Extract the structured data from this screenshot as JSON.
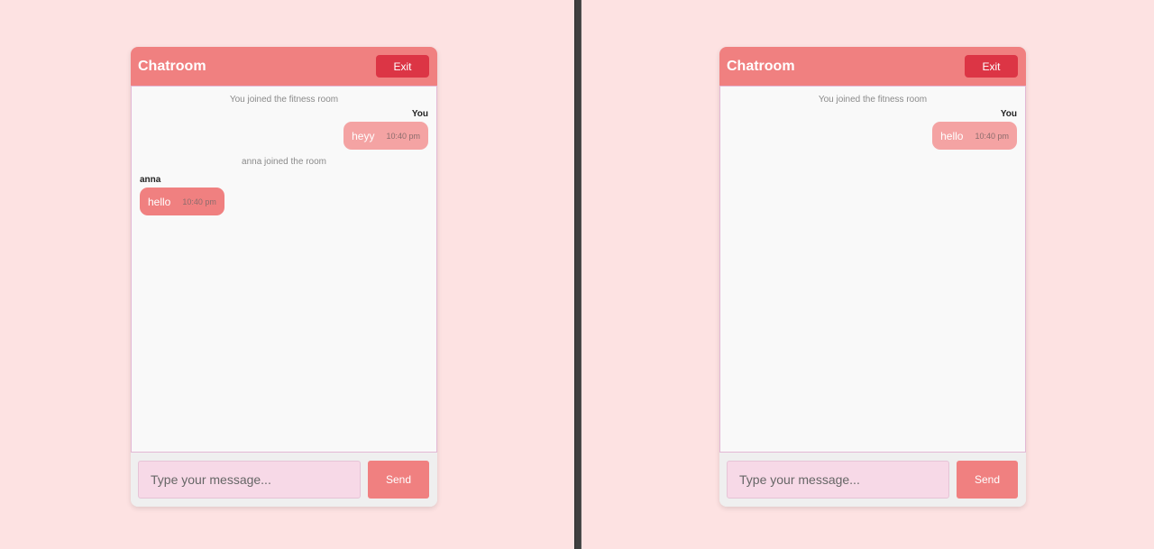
{
  "panes": [
    {
      "header": {
        "title": "Chatroom",
        "exit_label": "Exit"
      },
      "messages": {
        "sys_joined": "You joined the fitness room",
        "msg1": {
          "sender": "You",
          "text": "heyy",
          "time": "10:40 pm"
        },
        "sys_other_joined": "anna joined the room",
        "msg2": {
          "sender": "anna",
          "text": "hello",
          "time": "10:40 pm"
        }
      },
      "input": {
        "placeholder": "Type your message...",
        "send_label": "Send"
      }
    },
    {
      "header": {
        "title": "Chatroom",
        "exit_label": "Exit"
      },
      "messages": {
        "sys_joined": "You joined the fitness room",
        "msg1": {
          "sender": "You",
          "text": "hello",
          "time": "10:40 pm"
        }
      },
      "input": {
        "placeholder": "Type your message...",
        "send_label": "Send"
      }
    }
  ],
  "colors": {
    "background": "#fde2e2",
    "header": "#f08080",
    "exit_button": "#dc3545",
    "own_bubble": "#f4a3a3",
    "other_bubble": "#f08080",
    "input_field": "#f7d9e7"
  }
}
